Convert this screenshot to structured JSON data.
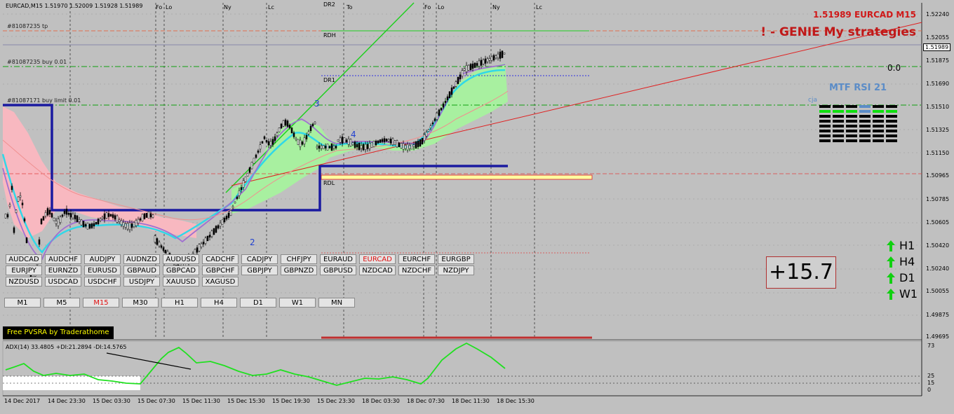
{
  "header": {
    "info": "EURCAD,M15  1.51970 1.52009 1.51928 1.51989"
  },
  "title_overlay": {
    "price_symbol": "1.51989 EURCAD M15",
    "genie": "! - GENIE My strategies"
  },
  "orders": [
    {
      "label": "#81087235 tp"
    },
    {
      "label": "#81087235 buy 0.01"
    },
    {
      "label": "#81087171 buy limit 0.01"
    }
  ],
  "chart_labels": {
    "rdh": "RDH",
    "dr1": "DR1",
    "dr2": "DR2",
    "rdl": "RDL",
    "wave_2": "2",
    "wave_3": "3",
    "wave_4": "4"
  },
  "session_labels": [
    "Fo",
    "Lo",
    "Ny",
    "Lc",
    "DR2",
    "To",
    "Fo",
    "Lo",
    "Ny",
    "Lc"
  ],
  "price_axis": {
    "ticks": [
      "1.52240",
      "1.52055",
      "1.51989",
      "1.51875",
      "1.51690",
      "1.51510",
      "1.51325",
      "1.51150",
      "1.50965",
      "1.50785",
      "1.50605",
      "1.50420",
      "1.50240",
      "1.50055",
      "1.49875",
      "1.49695"
    ],
    "current_price": "1.51989"
  },
  "time_axis": {
    "ticks": [
      "14 Dec 2017",
      "14 Dec 23:30",
      "15 Dec 03:30",
      "15 Dec 07:30",
      "15 Dec 11:30",
      "15 Dec 15:30",
      "15 Dec 19:30",
      "15 Dec 23:30",
      "18 Dec 03:30",
      "18 Dec 07:30",
      "18 Dec 11:30",
      "18 Dec 15:30"
    ]
  },
  "symbol_buttons": [
    {
      "label": "AUDCAD"
    },
    {
      "label": "AUDCHF"
    },
    {
      "label": "AUDJPY"
    },
    {
      "label": "AUDNZD"
    },
    {
      "label": "AUDUSD"
    },
    {
      "label": "CADCHF"
    },
    {
      "label": "CADJPY"
    },
    {
      "label": "CHFJPY"
    },
    {
      "label": "EURAUD"
    },
    {
      "label": "EURCAD",
      "active": true
    },
    {
      "label": "EURCHF"
    },
    {
      "label": "EURGBP"
    },
    {
      "label": "EURJPY"
    },
    {
      "label": "EURNZD"
    },
    {
      "label": "EURUSD"
    },
    {
      "label": "GBPAUD"
    },
    {
      "label": "GBPCAD"
    },
    {
      "label": "GBPCHF"
    },
    {
      "label": "GBPJPY"
    },
    {
      "label": "GBPNZD"
    },
    {
      "label": "GBPUSD"
    },
    {
      "label": "NZDCAD"
    },
    {
      "label": "NZDCHF"
    },
    {
      "label": "NZDJPY"
    },
    {
      "label": "NZDUSD"
    },
    {
      "label": "USDCAD"
    },
    {
      "label": "USDCHF"
    },
    {
      "label": "USDJPY"
    },
    {
      "label": "XAUUSD"
    },
    {
      "label": "XAGUSD"
    }
  ],
  "timeframe_buttons": [
    {
      "label": "M1"
    },
    {
      "label": "M5"
    },
    {
      "label": "M15",
      "active": true
    },
    {
      "label": "M30"
    },
    {
      "label": "H1"
    },
    {
      "label": "H4"
    },
    {
      "label": "D1"
    },
    {
      "label": "W1"
    },
    {
      "label": "MN"
    }
  ],
  "pvsra_label": "Free  PVSRA  by  Traderathome",
  "mtf_rsi": {
    "title": "MTF RSI  21",
    "cja": "cja",
    "zero": "0.0"
  },
  "profit": "+15.7",
  "trend_arrows": [
    {
      "tf": "H1",
      "direction": "up"
    },
    {
      "tf": "H4",
      "direction": "up"
    },
    {
      "tf": "D1",
      "direction": "up"
    },
    {
      "tf": "W1",
      "direction": "up"
    }
  ],
  "adx": {
    "label": "ADX(14) 33.4805 +DI:21.2894 -DI:14.5765",
    "levels": [
      "73",
      "25",
      "15",
      "0"
    ]
  },
  "colors": {
    "background": "#c0c0c0",
    "bull_cloud": "#a8f0a0",
    "bear_cloud": "#f8b8c0",
    "support_line": "#1a1aa0",
    "trend_red": "#e02020",
    "trend_green": "#20d020",
    "ema_cyan": "#30d8e8",
    "ema_purple": "#a070d0"
  }
}
